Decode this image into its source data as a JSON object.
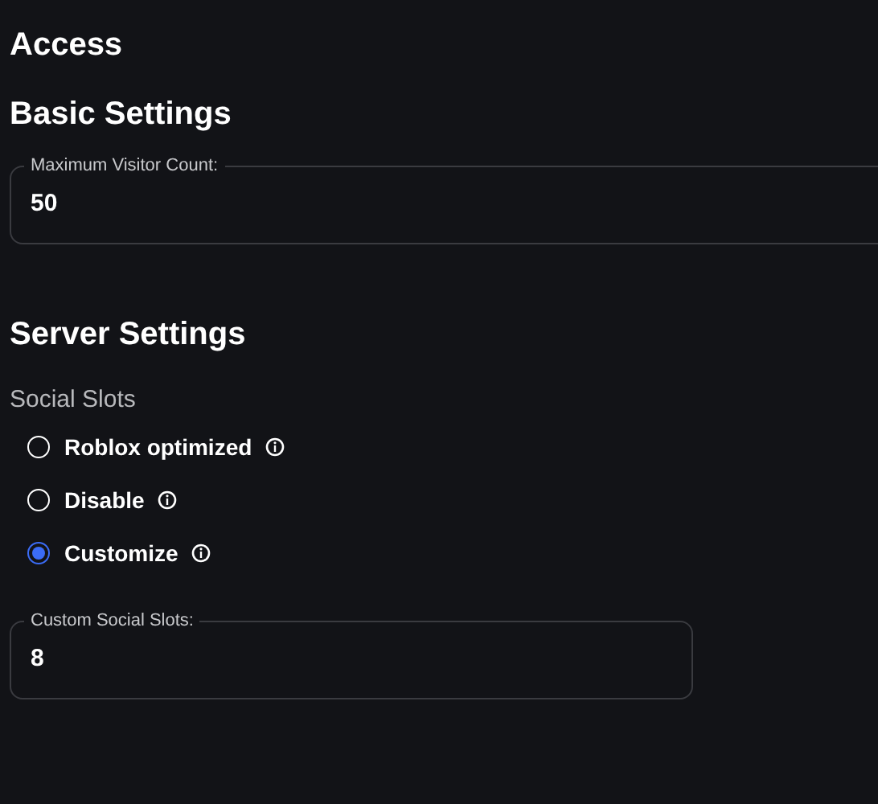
{
  "page_title": "Access",
  "basic_settings": {
    "heading": "Basic Settings",
    "max_visitor_field": {
      "label": "Maximum Visitor Count:",
      "value": "50"
    }
  },
  "server_settings": {
    "heading": "Server Settings",
    "social_slots": {
      "label": "Social Slots",
      "options": [
        {
          "label": "Roblox optimized",
          "selected": false
        },
        {
          "label": "Disable",
          "selected": false
        },
        {
          "label": "Customize",
          "selected": true
        }
      ]
    },
    "custom_slots_field": {
      "label": "Custom Social Slots:",
      "value": "8"
    }
  }
}
